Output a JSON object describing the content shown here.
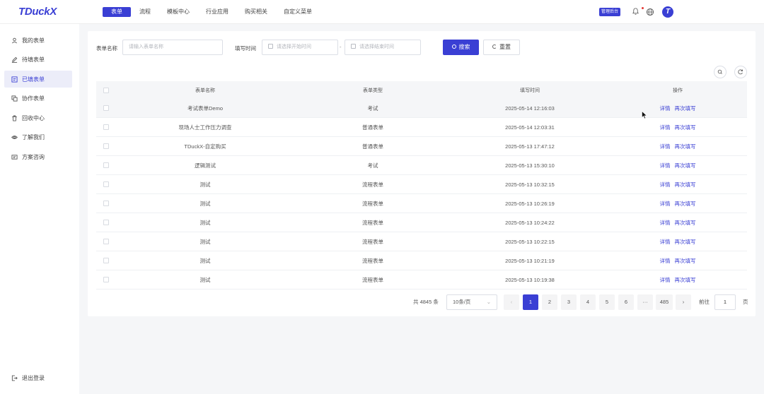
{
  "app": {
    "logo": "TDuckX"
  },
  "nav": {
    "items": [
      "表单",
      "流程",
      "模板中心",
      "行业应用",
      "购买相关",
      "自定义菜单"
    ],
    "admin_badge": "管理后台",
    "avatar": "T"
  },
  "sidebar": {
    "items": [
      {
        "label": "我的表单",
        "icon": "user-icon"
      },
      {
        "label": "待填表单",
        "icon": "edit-icon"
      },
      {
        "label": "已填表单",
        "icon": "filled-form-icon"
      },
      {
        "label": "协作表单",
        "icon": "collab-icon"
      },
      {
        "label": "回收中心",
        "icon": "trash-icon"
      },
      {
        "label": "了解我们",
        "icon": "eye-icon"
      },
      {
        "label": "方案咨询",
        "icon": "consult-icon"
      }
    ],
    "logout": "退出登录"
  },
  "search": {
    "form_name_label": "表单名称",
    "form_name_placeholder": "请输入表单名称",
    "fill_time_label": "填写时间",
    "start_placeholder": "请选择开始时间",
    "end_placeholder": "请选择结束时间",
    "range_sep": "-",
    "search_btn": "搜索",
    "reset_btn": "重置"
  },
  "table": {
    "headers": [
      "表单名称",
      "表单类型",
      "填写时间",
      "操作"
    ],
    "rows": [
      {
        "name": "考试表单Demo",
        "type": "考试",
        "time": "2025-05-14 12:16:03"
      },
      {
        "name": "现场人士工作压力调查",
        "type": "普通表单",
        "time": "2025-05-14 12:03:31"
      },
      {
        "name": "TDuckX-自定购买",
        "type": "普通表单",
        "time": "2025-05-13 17:47:12"
      },
      {
        "name": "逻辑测试",
        "type": "考试",
        "time": "2025-05-13 15:30:10"
      },
      {
        "name": "测试",
        "type": "流程表单",
        "time": "2025-05-13 10:32:15"
      },
      {
        "name": "测试",
        "type": "流程表单",
        "time": "2025-05-13 10:26:19"
      },
      {
        "name": "测试",
        "type": "流程表单",
        "time": "2025-05-13 10:24:22"
      },
      {
        "name": "测试",
        "type": "流程表单",
        "time": "2025-05-13 10:22:15"
      },
      {
        "name": "测试",
        "type": "流程表单",
        "time": "2025-05-13 10:21:19"
      },
      {
        "name": "测试",
        "type": "流程表单",
        "time": "2025-05-13 10:19:38"
      }
    ],
    "detail_link": "详情",
    "refill_link": "再次填写"
  },
  "pagination": {
    "total": "共 4845 条",
    "page_size": "10条/页",
    "prev": "‹",
    "pages": [
      "1",
      "2",
      "3",
      "4",
      "5",
      "6",
      "···",
      "485"
    ],
    "next": "›",
    "goto_label": "前往",
    "goto_value": "1",
    "goto_suffix": "页"
  },
  "colors": {
    "accent": "#3a3fd4",
    "notify_dot": "#e53935"
  }
}
